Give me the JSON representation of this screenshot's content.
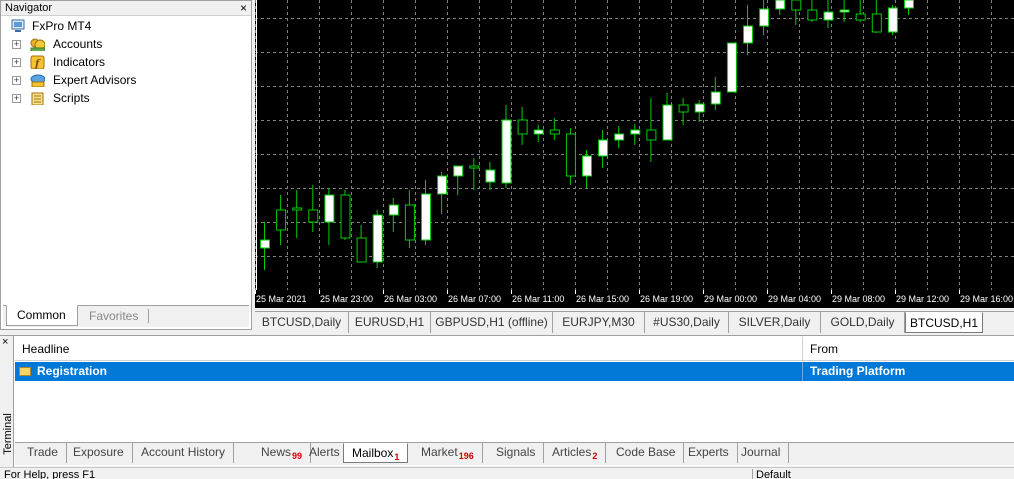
{
  "navigator": {
    "title": "Navigator",
    "close": "×",
    "root": "FxPro MT4",
    "items": [
      {
        "label": "Accounts",
        "icon": "accounts-icon"
      },
      {
        "label": "Indicators",
        "icon": "indicators-icon"
      },
      {
        "label": "Expert Advisors",
        "icon": "expert-advisors-icon"
      },
      {
        "label": "Scripts",
        "icon": "scripts-icon"
      }
    ],
    "tabs": [
      "Common",
      "Favorites"
    ]
  },
  "chart": {
    "symbol": "BTCUSD,H1",
    "background": "#000000",
    "grid_color": "#808080",
    "bull_color": "#ffffff",
    "bear_color": "#000000",
    "wick_color": "#00cc00",
    "x_labels": [
      "25 Mar 2021",
      "25 Mar 23:00",
      "26 Mar 03:00",
      "26 Mar 07:00",
      "26 Mar 11:00",
      "26 Mar 15:00",
      "26 Mar 19:00",
      "29 Mar 00:00",
      "29 Mar 04:00",
      "29 Mar 08:00",
      "29 Mar 12:00",
      "29 Mar 16:00"
    ]
  },
  "chart_tabs": [
    "BTCUSD,Daily",
    "EURUSD,H1",
    "GBPUSD,H1 (offline)",
    "EURJPY,M30",
    "#US30,Daily",
    "SILVER,Daily",
    "GOLD,Daily",
    "BTCUSD,H1"
  ],
  "terminal": {
    "title": "Terminal",
    "close": "×",
    "columns": {
      "headline": "Headline",
      "from": "From"
    },
    "rows": [
      {
        "headline": "Registration",
        "from": "Trading Platform"
      }
    ],
    "tabs": [
      {
        "label": "Trade",
        "badge": ""
      },
      {
        "label": "Exposure",
        "badge": ""
      },
      {
        "label": "Account History",
        "badge": ""
      },
      {
        "label": "News",
        "badge": "99"
      },
      {
        "label": "Alerts",
        "badge": ""
      },
      {
        "label": "Mailbox",
        "badge": "1"
      },
      {
        "label": "Market",
        "badge": "196"
      },
      {
        "label": "Signals",
        "badge": ""
      },
      {
        "label": "Articles",
        "badge": "2"
      },
      {
        "label": "Code Base",
        "badge": ""
      },
      {
        "label": "Experts",
        "badge": ""
      },
      {
        "label": "Journal",
        "badge": ""
      }
    ]
  },
  "statusbar": {
    "left": "For Help, press F1",
    "right": "Default"
  }
}
